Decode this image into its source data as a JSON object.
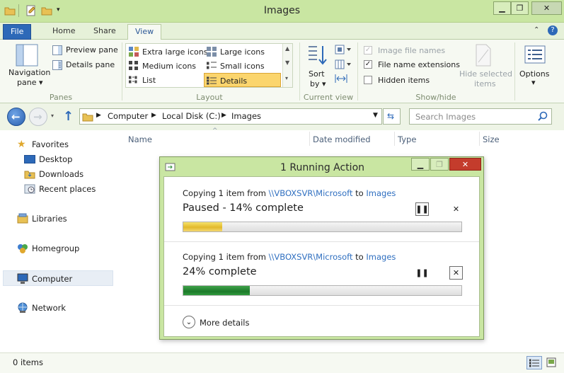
{
  "window": {
    "title": "Images"
  },
  "tabs": [
    {
      "label": "File"
    },
    {
      "label": "Home"
    },
    {
      "label": "Share"
    },
    {
      "label": "View"
    }
  ],
  "ribbon": {
    "panes": {
      "navigation_pane_line1": "Navigation",
      "navigation_pane_line2": "pane ▾",
      "preview_pane": "Preview pane",
      "details_pane": "Details pane",
      "group_label": "Panes"
    },
    "layout": {
      "options": [
        "Extra large icons",
        "Large icons",
        "Medium icons",
        "Small icons",
        "List",
        "Details"
      ],
      "selected": "Details",
      "group_label": "Layout"
    },
    "current_view": {
      "sort_line1": "Sort",
      "sort_line2": "by ▾",
      "group_label": "Current view"
    },
    "show_hide": {
      "image_file_names": "Image file names",
      "image_file_names_checked": true,
      "file_name_extensions": "File name extensions",
      "file_name_extensions_checked": true,
      "hidden_items": "Hidden items",
      "hidden_items_checked": false,
      "hide_selected_line1": "Hide selected",
      "hide_selected_line2": "items",
      "group_label": "Show/hide"
    },
    "options_label": "Options"
  },
  "address": {
    "crumbs": [
      "Computer",
      "Local Disk (C:)",
      "Images"
    ],
    "search_placeholder": "Search Images"
  },
  "nav": {
    "favorites": "Favorites",
    "desktop": "Desktop",
    "downloads": "Downloads",
    "recent_places": "Recent places",
    "libraries": "Libraries",
    "homegroup": "Homegroup",
    "computer": "Computer",
    "network": "Network"
  },
  "columns": [
    "Name",
    "Date modified",
    "Type",
    "Size"
  ],
  "status": {
    "items": "0 items"
  },
  "dialog": {
    "title": "1 Running Action",
    "operations": [
      {
        "prefix": "Copying 1 item from ",
        "source": "\\\\VBOXSVR\\Microsoft",
        "mid": " to ",
        "dest": "Images",
        "status": "Paused - 14% complete",
        "progress": 0.14,
        "state": "paused"
      },
      {
        "prefix": "Copying 1 item from ",
        "source": "\\\\VBOXSVR\\Microsoft",
        "mid": " to ",
        "dest": "Images",
        "status": "24% complete",
        "progress": 0.24,
        "state": "running"
      }
    ],
    "more_details": "More details"
  },
  "colors": {
    "chrome": "#c9e6a2",
    "file_tab": "#2d69b8",
    "link": "#2f6fc0",
    "progress_paused": "#e2b92c",
    "progress_running": "#1c7a2a"
  }
}
